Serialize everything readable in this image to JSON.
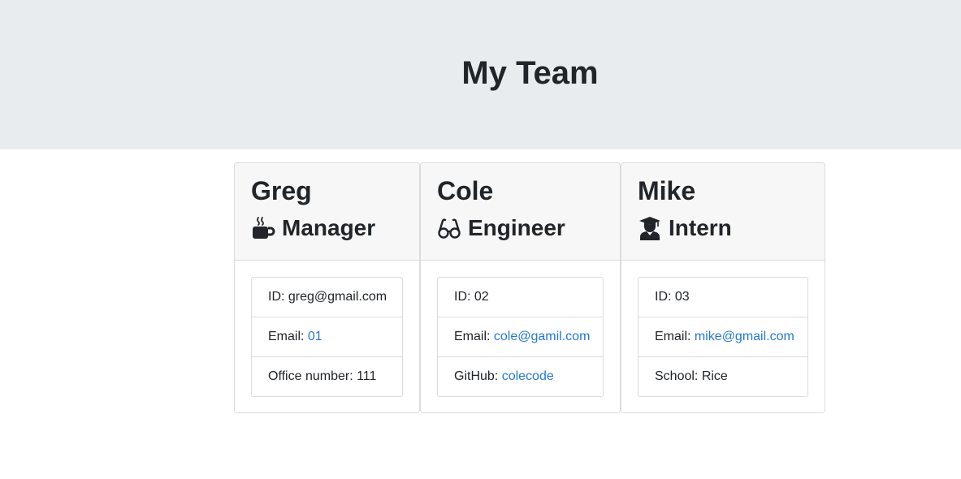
{
  "header": {
    "title": "My Team"
  },
  "cards": [
    {
      "name": "Greg",
      "role": "Manager",
      "icon": "mug-icon",
      "id_label": "ID: ",
      "id_value": "greg@gmail.com",
      "email_label": "Email: ",
      "email_value": "01",
      "extra_label": "Office number: ",
      "extra_value": "111"
    },
    {
      "name": "Cole",
      "role": "Engineer",
      "icon": "glasses-icon",
      "id_label": "ID: ",
      "id_value": "02",
      "email_label": "Email: ",
      "email_value": "cole@gamil.com",
      "extra_label": "GitHub: ",
      "extra_value": "colecode"
    },
    {
      "name": "Mike",
      "role": "Intern",
      "icon": "graduate-icon",
      "id_label": "ID: ",
      "id_value": "03",
      "email_label": "Email: ",
      "email_value": "mike@gmail.com",
      "extra_label": "School: ",
      "extra_value": "Rice"
    }
  ],
  "colors": {
    "header_bg": "#e9ecef",
    "card_header_bg": "#f7f7f7",
    "link": "#2479d2",
    "text": "#212529"
  }
}
